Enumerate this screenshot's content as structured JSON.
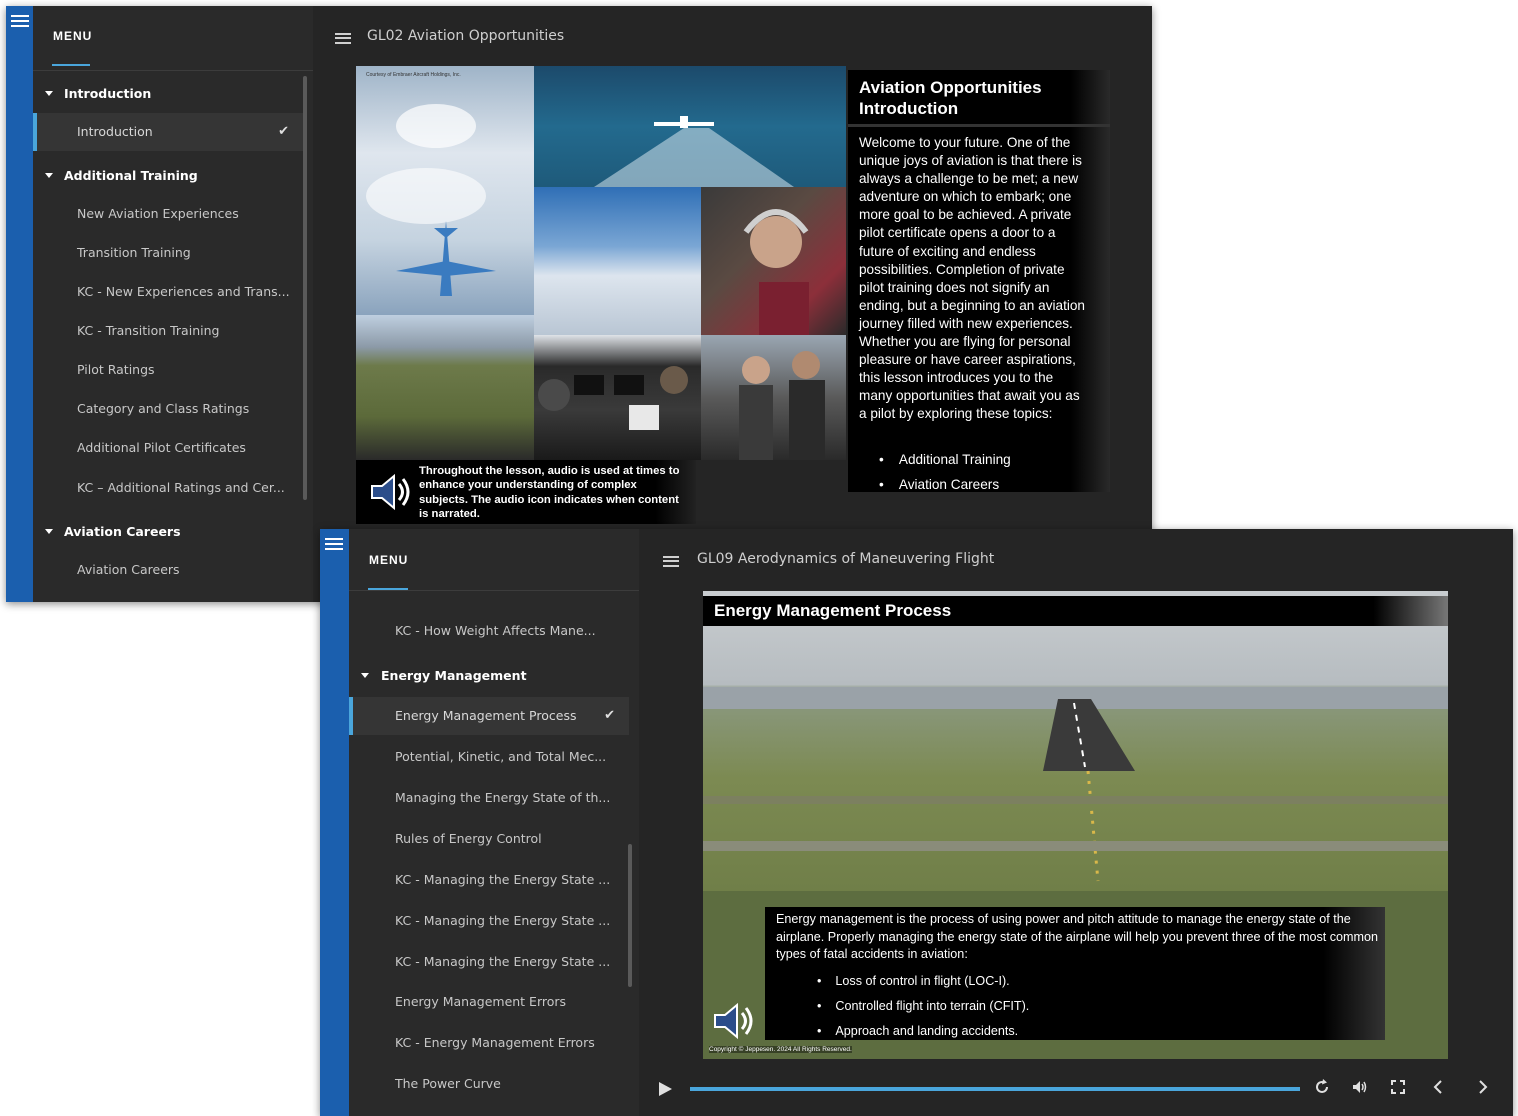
{
  "window1": {
    "menu_title": "MENU",
    "lesson_title": "GL02 Aviation Opportunities",
    "menu_items": [
      {
        "label": "Introduction",
        "type": "section"
      },
      {
        "label": "Introduction",
        "type": "item",
        "active": true,
        "checked": true
      },
      {
        "label": "Additional Training",
        "type": "section"
      },
      {
        "label": "New Aviation Experiences",
        "type": "item"
      },
      {
        "label": "Transition Training",
        "type": "item"
      },
      {
        "label": "KC - New Experiences and Trans...",
        "type": "item"
      },
      {
        "label": "KC - Transition Training",
        "type": "item"
      },
      {
        "label": "Pilot Ratings",
        "type": "item"
      },
      {
        "label": "Category and Class Ratings",
        "type": "item"
      },
      {
        "label": "Additional Pilot Certificates",
        "type": "item"
      },
      {
        "label": "KC – Additional Ratings and Cer...",
        "type": "item"
      },
      {
        "label": "Aviation Careers",
        "type": "section"
      },
      {
        "label": "Aviation Careers",
        "type": "item"
      }
    ],
    "slide": {
      "credit": "Courtesy of Embraer Aircraft Holdings, Inc.",
      "heading_line1": "Aviation Opportunities",
      "heading_line2": "Introduction",
      "body": "Welcome to your future. One of the unique joys of aviation is that there is always a challenge to be met; a new adventure on which to embark; one more goal to be achieved. A private pilot certificate opens a door to a future of exciting and endless possibilities. Completion of private pilot training does not signify an ending, but a beginning to an aviation journey filled with new experiences. Whether you are flying for personal pleasure or have career aspirations, this lesson introduces you to the many opportunities that await you as a pilot by exploring these topics:",
      "bullets": [
        "Additional Training",
        "Aviation Careers"
      ],
      "audio_note": "Throughout the lesson, audio is used at times to enhance your understanding of complex subjects. The audio icon indicates when content is narrated."
    }
  },
  "window2": {
    "menu_title": "MENU",
    "lesson_title": "GL09 Aerodynamics of Maneuvering Flight",
    "menu_items": [
      {
        "label": "KC - How Weight Affects Mane...",
        "type": "item"
      },
      {
        "label": "Energy Management",
        "type": "section"
      },
      {
        "label": "Energy Management Process",
        "type": "item",
        "active": true,
        "checked": true
      },
      {
        "label": "Potential, Kinetic, and Total Mec...",
        "type": "item"
      },
      {
        "label": "Managing the Energy State of th...",
        "type": "item"
      },
      {
        "label": "Rules of Energy Control",
        "type": "item"
      },
      {
        "label": "KC - Managing the Energy State ...",
        "type": "item"
      },
      {
        "label": "KC - Managing the Energy State ...",
        "type": "item"
      },
      {
        "label": "KC - Managing the Energy State ...",
        "type": "item"
      },
      {
        "label": "Energy Management Errors",
        "type": "item"
      },
      {
        "label": "KC - Energy Management Errors",
        "type": "item"
      },
      {
        "label": "The Power Curve",
        "type": "item"
      }
    ],
    "slide": {
      "heading": "Energy Management Process",
      "body": "Energy management is the process of using power and pitch attitude to manage the energy state of the airplane. Properly managing the energy state of the airplane will help you prevent three of the most common types of fatal accidents in aviation:",
      "bullets": [
        "Loss of control in flight (LOC-I).",
        "Controlled flight into terrain (CFIT).",
        "Approach and landing accidents."
      ],
      "copyright": "Copyright © Jeppesen. 2024 All Rights Reserved."
    },
    "player": {
      "progress": 1.0,
      "accent_color": "#4aa6dc"
    }
  },
  "colors": {
    "sidebar_strip": "#1b5fae",
    "menu_bg": "#2a2a2a",
    "content_bg": "#252525",
    "accent": "#4aa6dc"
  },
  "icons": [
    "menu-icon",
    "chevron-down-icon",
    "check-icon",
    "speaker-icon",
    "play-icon",
    "replay-icon",
    "volume-icon",
    "fullscreen-icon",
    "chevron-left-icon",
    "chevron-right-icon"
  ]
}
